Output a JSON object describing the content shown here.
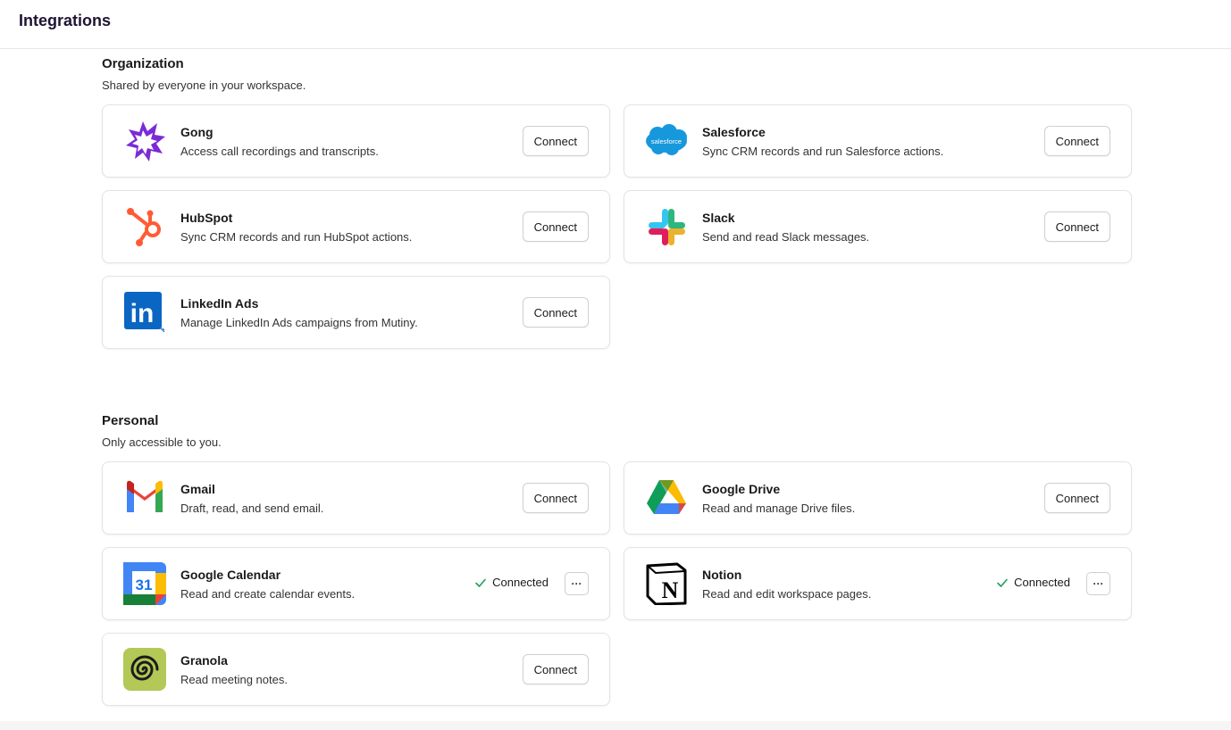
{
  "header": {
    "title": "Integrations"
  },
  "organization": {
    "title": "Organization",
    "subtitle": "Shared by everyone in your workspace.",
    "items": [
      {
        "name": "Gong",
        "description": "Access call recordings and transcripts.",
        "action": "Connect",
        "icon": "gong-icon"
      },
      {
        "name": "Salesforce",
        "description": "Sync CRM records and run Salesforce actions.",
        "action": "Connect",
        "icon": "salesforce-icon",
        "logo_text": "salesforce"
      },
      {
        "name": "HubSpot",
        "description": "Sync CRM records and run HubSpot actions.",
        "action": "Connect",
        "icon": "hubspot-icon"
      },
      {
        "name": "Slack",
        "description": "Send and read Slack messages.",
        "action": "Connect",
        "icon": "slack-icon"
      },
      {
        "name": "LinkedIn Ads",
        "description": "Manage LinkedIn Ads campaigns from Mutiny.",
        "action": "Connect",
        "icon": "linkedin-icon",
        "logo_text": "in"
      }
    ]
  },
  "personal": {
    "title": "Personal",
    "subtitle": "Only accessible to you.",
    "items": [
      {
        "name": "Gmail",
        "description": "Draft, read, and send email.",
        "action": "Connect",
        "icon": "gmail-icon"
      },
      {
        "name": "Google Drive",
        "description": "Read and manage Drive files.",
        "action": "Connect",
        "icon": "google-drive-icon"
      },
      {
        "name": "Google Calendar",
        "description": "Read and create calendar events.",
        "status": "Connected",
        "more": "···",
        "icon": "google-calendar-icon",
        "logo_text": "31"
      },
      {
        "name": "Notion",
        "description": "Read and edit workspace pages.",
        "status": "Connected",
        "more": "···",
        "icon": "notion-icon",
        "logo_text": "N"
      },
      {
        "name": "Granola",
        "description": "Read meeting notes.",
        "action": "Connect",
        "icon": "granola-icon"
      }
    ]
  },
  "colors": {
    "title": "#1f1433",
    "connected_check": "#1e9e5a",
    "border": "#e3e3e3"
  }
}
